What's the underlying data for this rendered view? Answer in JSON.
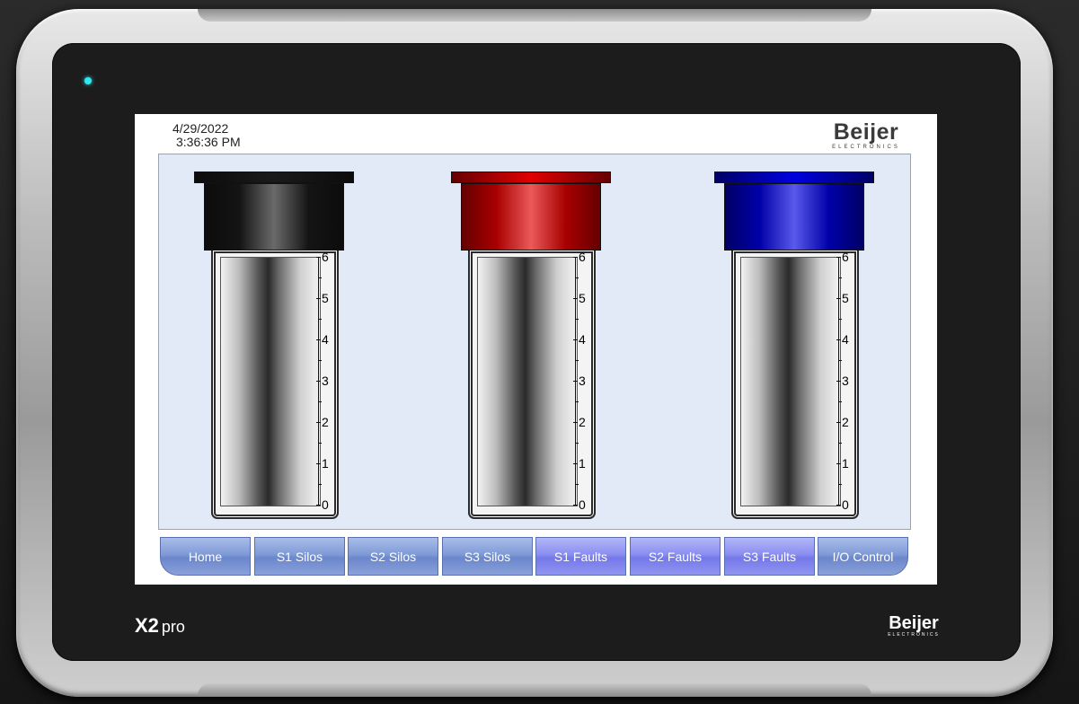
{
  "device": {
    "model_bold": "X2",
    "model_suffix": "pro",
    "bezel_brand": "Beijer",
    "bezel_brand_sub": "ELECTRONICS"
  },
  "header": {
    "date": "4/29/2022",
    "time": "3:36:36 PM",
    "logo_main": "Beijer",
    "logo_sub": "ELECTRONICS"
  },
  "silos": [
    {
      "name": "silo-black",
      "cap_color": "#1a1a1a",
      "level": 6
    },
    {
      "name": "silo-red",
      "cap_color": "#e00000",
      "level": 6
    },
    {
      "name": "silo-blue",
      "cap_color": "#0000e0",
      "level": 6
    }
  ],
  "scale_labels": [
    "6",
    "5",
    "4",
    "3",
    "2",
    "1",
    "0"
  ],
  "nav": [
    {
      "label": "Home",
      "style": "blue"
    },
    {
      "label": "S1 Silos",
      "style": "blue"
    },
    {
      "label": "S2 Silos",
      "style": "blue"
    },
    {
      "label": "S3 Silos",
      "style": "blue"
    },
    {
      "label": "S1 Faults",
      "style": "violet"
    },
    {
      "label": "S2 Faults",
      "style": "violet"
    },
    {
      "label": "S3 Faults",
      "style": "violet"
    },
    {
      "label": "I/O Control",
      "style": "blue"
    }
  ],
  "colors": {
    "led": "#2ee8f2",
    "content_bg": "#e2e9f7",
    "nav_blue": "#7f9ad6",
    "nav_violet": "#8a8ef0"
  }
}
